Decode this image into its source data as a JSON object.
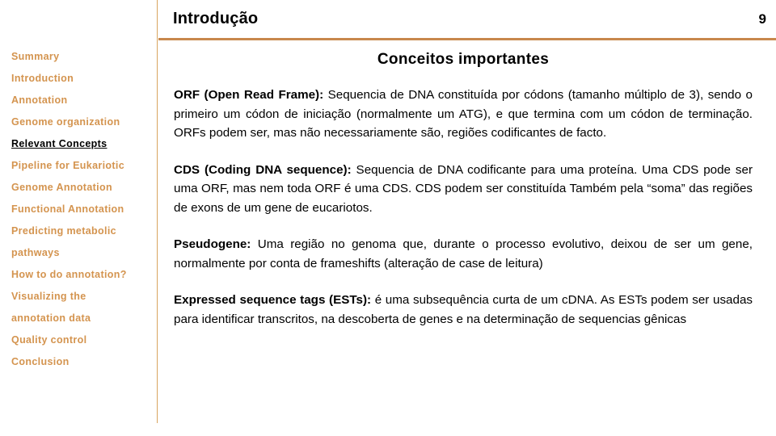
{
  "header": {
    "title": "Introdução",
    "slide_number": "9"
  },
  "colors": {
    "accent_rule": "#C8884C",
    "sidebar_link": "#D4944F",
    "divider": "#D8A45E",
    "active_item": "#000000"
  },
  "sidebar": {
    "items": [
      {
        "label": "Summary",
        "active": false
      },
      {
        "label": "Introduction",
        "active": false
      },
      {
        "label": "Annotation",
        "active": false
      },
      {
        "label": "Genome organization",
        "active": false
      },
      {
        "label": "Relevant Concepts",
        "active": true
      },
      {
        "label": "Pipeline for Eukariotic",
        "active": false
      },
      {
        "label": "Genome Annotation",
        "active": false
      },
      {
        "label": "Functional Annotation",
        "active": false
      },
      {
        "label": "Predicting metabolic",
        "active": false
      },
      {
        "label": "pathways",
        "active": false
      },
      {
        "label": "How to do annotation?",
        "active": false
      },
      {
        "label": "Visualizing the",
        "active": false
      },
      {
        "label": "annotation data",
        "active": false
      },
      {
        "label": "Quality control",
        "active": false
      },
      {
        "label": "Conclusion",
        "active": false
      }
    ]
  },
  "main": {
    "subtitle": "Conceitos importantes",
    "paragraphs": [
      {
        "lead": "ORF (Open Read Frame):",
        "body": " Sequencia de DNA constituída por códons (tamanho múltiplo de 3), sendo o primeiro um códon de iniciação (normalmente um ATG), e que termina com um códon de terminação. ORFs podem ser, mas não necessariamente são, regiões codificantes de facto."
      },
      {
        "lead": "CDS (Coding DNA sequence):",
        "body": " Sequencia de DNA codificante para uma proteína. Uma CDS pode ser uma ORF, mas nem toda ORF é uma CDS. CDS podem ser constituída Também pela “soma” das regiões de exons de um gene de eucariotos."
      },
      {
        "lead": "Pseudogene:",
        "body": " Uma região no genoma que, durante o processo evolutivo, deixou de ser um gene, normalmente por conta de frameshifts (alteração de case de leitura)"
      },
      {
        "lead": "Expressed sequence tags (ESTs):",
        "body": " é uma subsequência curta de um cDNA. As ESTs podem ser usadas para identificar transcritos, na descoberta de genes e na determinação de sequencias gênicas"
      }
    ]
  }
}
